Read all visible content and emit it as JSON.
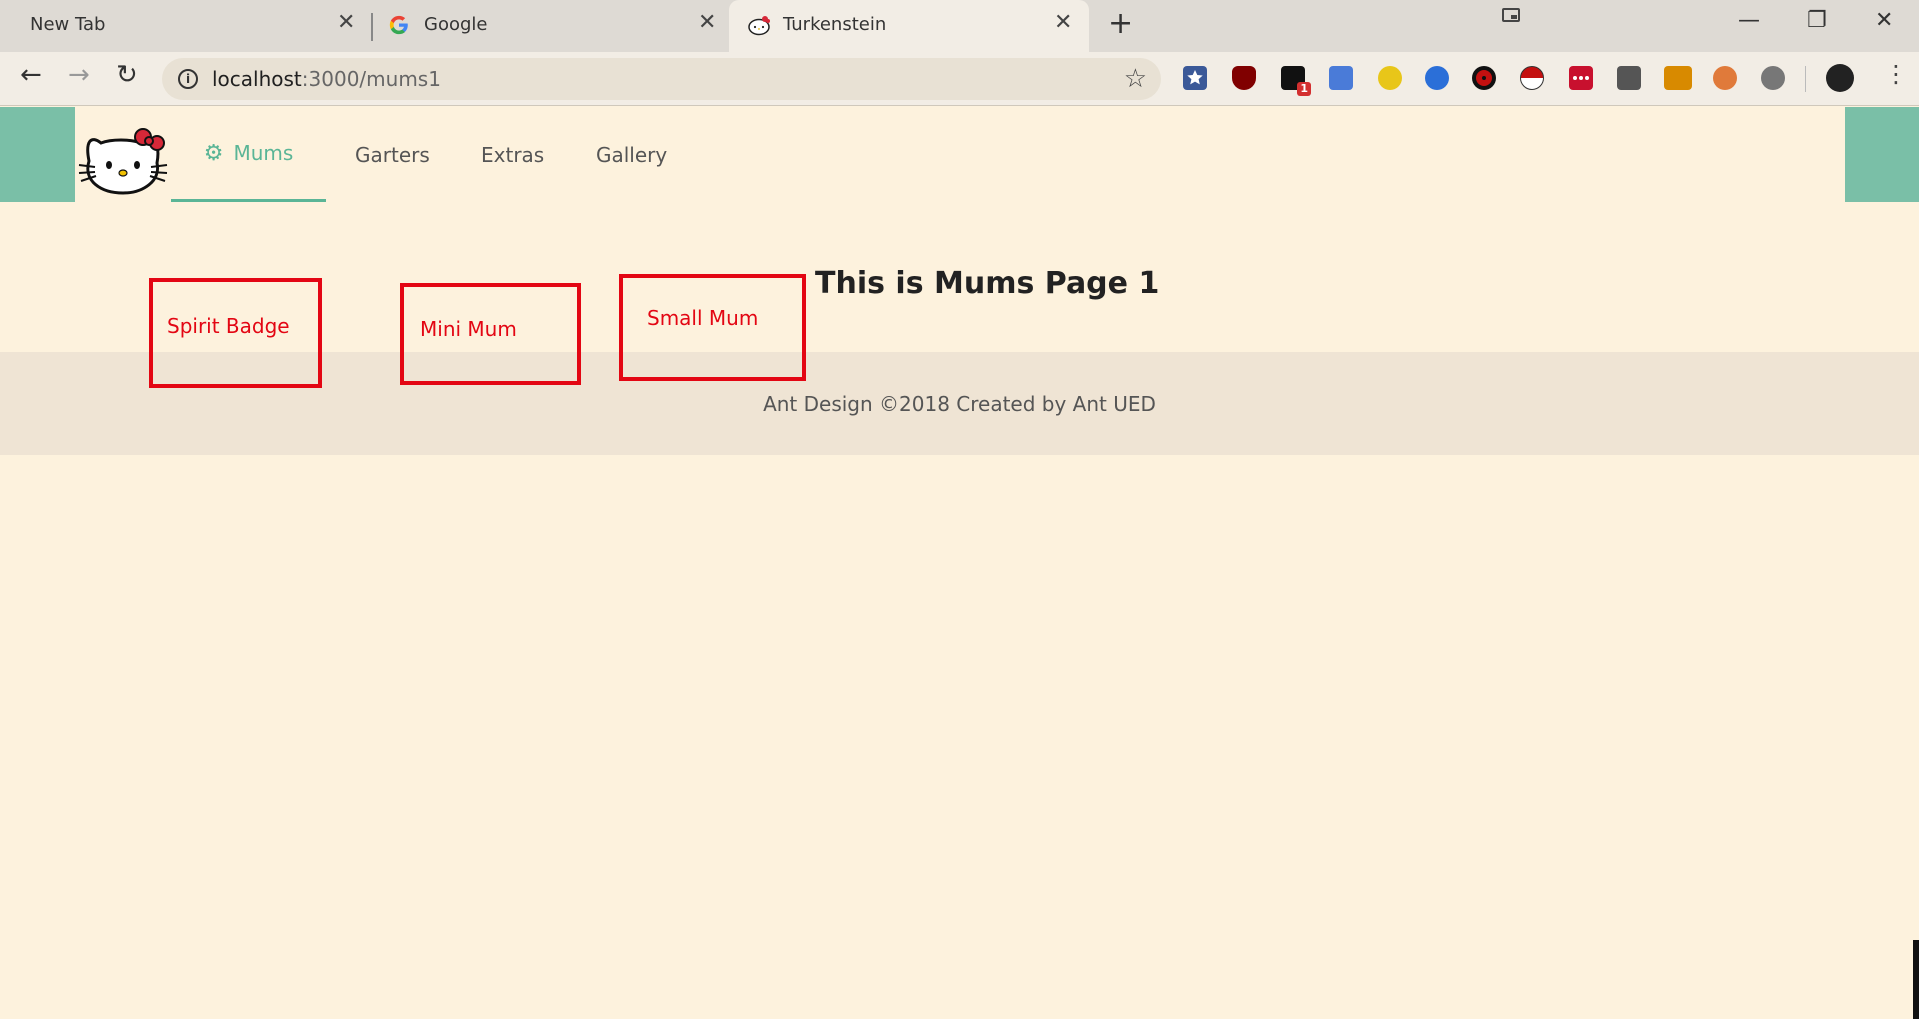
{
  "browser": {
    "tabs": [
      {
        "title": "New Tab"
      },
      {
        "title": "Google"
      },
      {
        "title": "Turkenstein"
      }
    ],
    "url_host": "localhost",
    "url_path": ":3000/mums1",
    "extension_icons": [
      "star-extension-icon",
      "ublock-icon",
      "notification-extension-icon",
      "google-translate-icon",
      "circle-extension-icon",
      "firefox-relay-icon",
      "sharingan-icon",
      "pokeball-icon",
      "lastpass-icon",
      "switch-extension-icon",
      "mts-extension-icon",
      "glasses-extension-icon",
      "spotify-icon"
    ],
    "ext_badge": "1"
  },
  "nav": {
    "items": [
      {
        "label": "Mums",
        "active": true,
        "icon": "gear-icon"
      },
      {
        "label": "Garters",
        "active": false
      },
      {
        "label": "Extras",
        "active": false
      },
      {
        "label": "Gallery",
        "active": false
      }
    ]
  },
  "content": {
    "boxes": [
      {
        "label": "Spirit Badge"
      },
      {
        "label": "Mini Mum"
      },
      {
        "label": "Small Mum"
      }
    ],
    "heading": "This is Mums Page 1"
  },
  "footer": {
    "text": "Ant Design ©2018 Created by Ant UED"
  },
  "colors": {
    "header_accent": "#7abfa7",
    "active_menu": "#5ab596",
    "box_border": "#e30613",
    "page_bg": "#fdf2dd"
  }
}
